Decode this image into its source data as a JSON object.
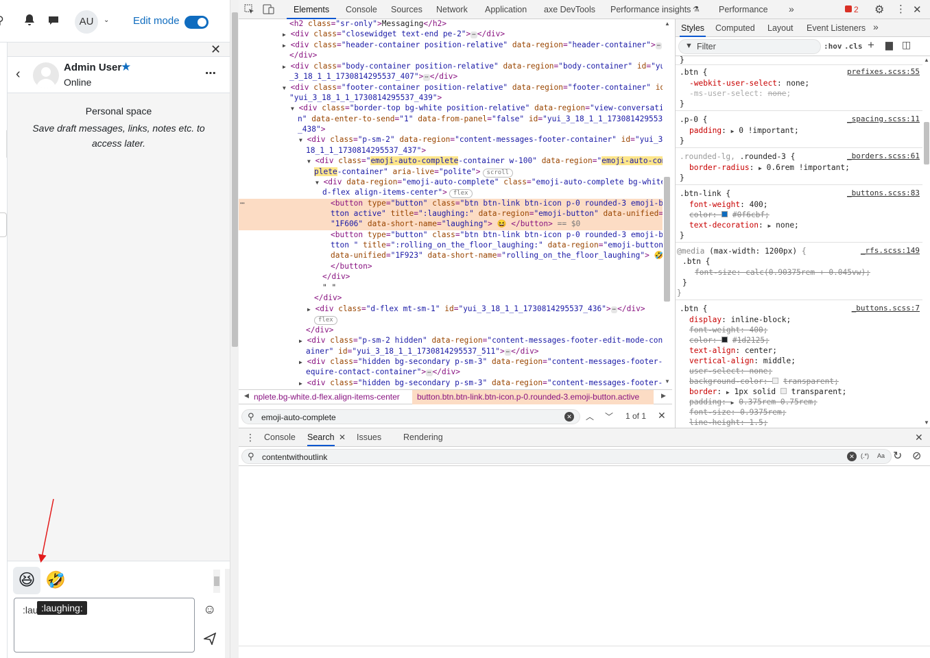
{
  "topnav": {
    "avatar_initials": "AU",
    "edit_mode_label": "Edit mode"
  },
  "drawer": {
    "user_name": "Admin User",
    "user_status": "Online",
    "personal_title": "Personal space",
    "personal_desc": "Save draft messages, links, notes etc. to access later.",
    "emoji_1": "😆",
    "emoji_2": "🤣",
    "input_value": ":lau",
    "tooltip": ":laughing:"
  },
  "devtools": {
    "tabs": [
      "Elements",
      "Console",
      "Sources",
      "Network",
      "Application",
      "axe DevTools",
      "Performance insights",
      "Performance"
    ],
    "error_count": "2",
    "styles_tabs": [
      "Styles",
      "Computed",
      "Layout",
      "Event Listeners"
    ],
    "filter_placeholder": "Filter",
    "hov": ":hov",
    "cls": ".cls",
    "breadcrumb_1": "nplete.bg-white.d-flex.align-items-center",
    "breadcrumb_2": "button.btn.btn-link.btn-icon.p-0.rounded-3.emoji-button.active",
    "dom_search_value": "emoji-auto-complete",
    "dom_search_count": "1 of 1",
    "drawer_tabs": [
      "Console",
      "Search",
      "Issues",
      "Rendering"
    ],
    "search_value": "contentwithoutlink",
    "search_opts": [
      "(.*)",
      "Aa"
    ]
  }
}
